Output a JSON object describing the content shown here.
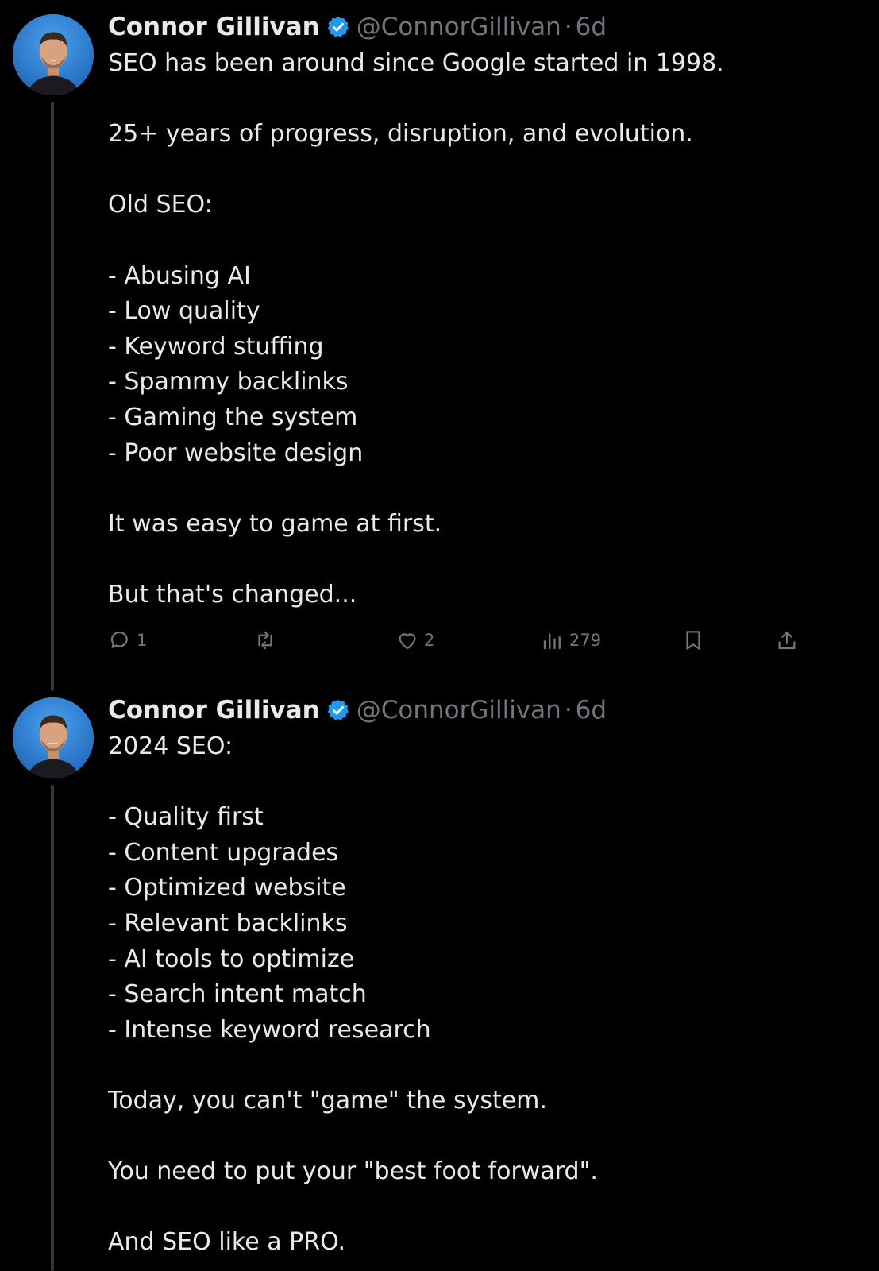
{
  "accent": "#1d9bf0",
  "tweets": [
    {
      "author": {
        "name": "Connor Gillivan",
        "handle": "@ConnorGillivan",
        "verified": true
      },
      "separator": "·",
      "time": "6d",
      "lines": [
        "SEO has been around since Google started in 1998.",
        "",
        "25+ years of progress, disruption, and evolution.",
        "",
        "Old SEO:",
        "",
        "- Abusing AI",
        "- Low quality",
        "- Keyword stuffing",
        "- Spammy backlinks",
        "- Gaming the system",
        "- Poor website design",
        "",
        "It was easy to game at first.",
        "",
        "But that's changed..."
      ],
      "actions": {
        "reply_count": "1",
        "retweet_count": "",
        "like_count": "2",
        "view_count": "279"
      }
    },
    {
      "author": {
        "name": "Connor Gillivan",
        "handle": "@ConnorGillivan",
        "verified": true
      },
      "separator": "·",
      "time": "6d",
      "lines": [
        "2024 SEO:",
        "",
        "- Quality first",
        "- Content upgrades",
        "- Optimized website",
        "- Relevant backlinks",
        "- AI tools to optimize",
        "- Search intent match",
        "- Intense keyword research",
        "",
        "Today, you can't \"game\" the system.",
        "",
        "You need to put your \"best foot forward\".",
        "",
        "And SEO like a PRO."
      ]
    }
  ]
}
